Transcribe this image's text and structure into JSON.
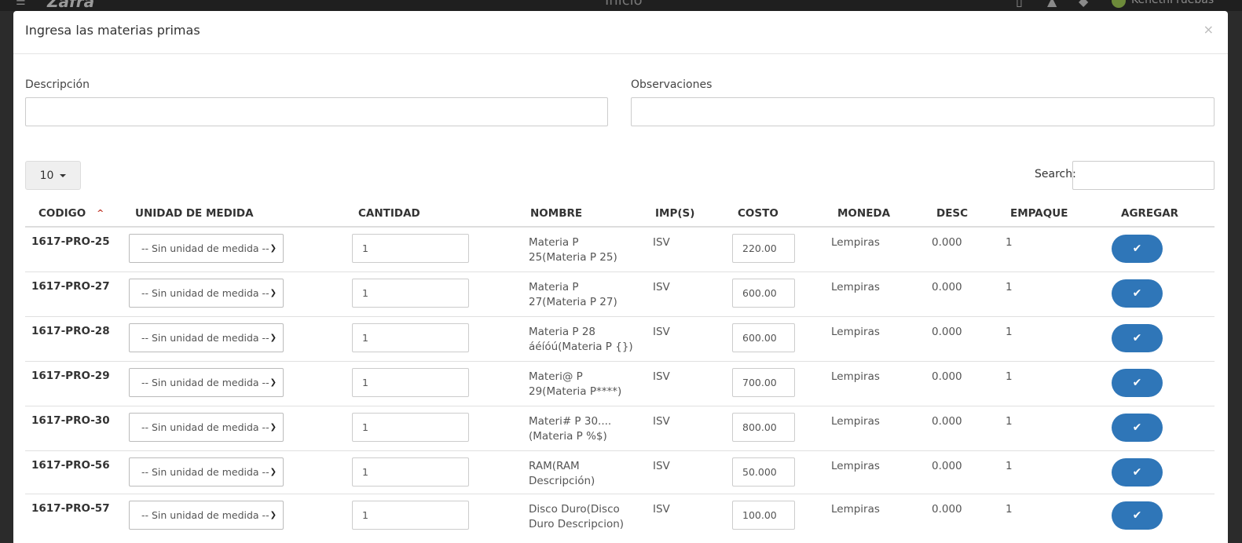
{
  "app": {
    "logo_text": "Zafra",
    "page_name": "Inicio",
    "user_name": "KenethPruebas"
  },
  "modal": {
    "title": "Ingresa las materias primas",
    "close_symbol": "×"
  },
  "form": {
    "descripcion_label": "Descripción",
    "descripcion_value": "",
    "observaciones_label": "Observaciones",
    "observaciones_value": ""
  },
  "table_controls": {
    "page_length": "10",
    "search_label": "Search:",
    "search_value": ""
  },
  "columns": [
    "CODIGO",
    "UNIDAD DE MEDIDA",
    "CANTIDAD",
    "NOMBRE",
    "IMP(S)",
    "COSTO",
    "MONEDA",
    "DESC",
    "EMPAQUE",
    "AGREGAR"
  ],
  "rows": [
    {
      "codigo": "1617-PRO-25",
      "unidad": "-- Sin unidad de medida --",
      "cantidad": "1",
      "nombre": "Materia P 25(Materia P 25)",
      "imp": "ISV",
      "costo": "220.00",
      "moneda": "Lempiras",
      "desc": "0.000",
      "empaque": "1"
    },
    {
      "codigo": "1617-PRO-27",
      "unidad": "-- Sin unidad de medida --",
      "cantidad": "1",
      "nombre": "Materia P 27(Materia P 27)",
      "imp": "ISV",
      "costo": "600.00",
      "moneda": "Lempiras",
      "desc": "0.000",
      "empaque": "1"
    },
    {
      "codigo": "1617-PRO-28",
      "unidad": "-- Sin unidad de medida --",
      "cantidad": "1",
      "nombre": "Materia P 28 áéíóú(Materia P {})",
      "imp": "ISV",
      "costo": "600.00",
      "moneda": "Lempiras",
      "desc": "0.000",
      "empaque": "1"
    },
    {
      "codigo": "1617-PRO-29",
      "unidad": "-- Sin unidad de medida --",
      "cantidad": "1",
      "nombre": "Materi@ P 29(Materia P****)",
      "imp": "ISV",
      "costo": "700.00",
      "moneda": "Lempiras",
      "desc": "0.000",
      "empaque": "1"
    },
    {
      "codigo": "1617-PRO-30",
      "unidad": "-- Sin unidad de medida --",
      "cantidad": "1",
      "nombre": "Materi# P 30.... (Materia P %$)",
      "imp": "ISV",
      "costo": "800.00",
      "moneda": "Lempiras",
      "desc": "0.000",
      "empaque": "1"
    },
    {
      "codigo": "1617-PRO-56",
      "unidad": "-- Sin unidad de medida --",
      "cantidad": "1",
      "nombre": "RAM(RAM Descripción)",
      "imp": "ISV",
      "costo": "50.000",
      "moneda": "Lempiras",
      "desc": "0.000",
      "empaque": "1"
    },
    {
      "codigo": "1617-PRO-57",
      "unidad": "-- Sin unidad de medida --",
      "cantidad": "1",
      "nombre": "Disco Duro(Disco Duro Descripcion)",
      "imp": "ISV",
      "costo": "100.00",
      "moneda": "Lempiras",
      "desc": "0.000",
      "empaque": "1"
    }
  ],
  "icons": {
    "sort": "chevron-up-icon",
    "add": "check-icon",
    "select_arrow": "chevron-down-icon"
  },
  "colors": {
    "primary": "#2f76b8",
    "sort_indicator": "#c0392b"
  }
}
